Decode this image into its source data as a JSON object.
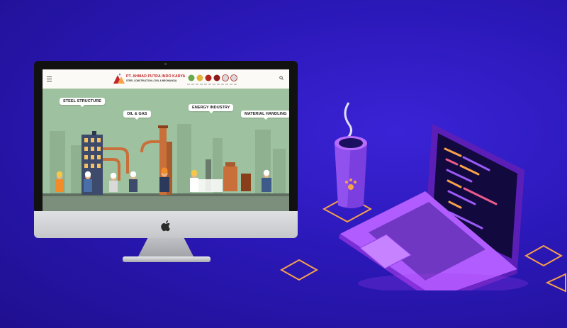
{
  "colors": {
    "background": "#2b18b8",
    "brand_red": "#c2262b",
    "hero_green": "#9ec19f",
    "accent_orange": "#f7a14a",
    "neon_purple": "#a63cf0"
  },
  "site": {
    "brand_name": "PT. AHMAD PUTRA INDO KARYA",
    "tagline": "STEEL CONSTRUCTION, CIVIL & MECHANICAL",
    "menu_icon": "hamburger-icon",
    "search_icon": "search-icon"
  },
  "hero": {
    "labels": [
      "STEEL STRUCTURE",
      "OIL & GAS",
      "ENERGY INDUSTRY",
      "MATERIAL HANDLING"
    ]
  }
}
